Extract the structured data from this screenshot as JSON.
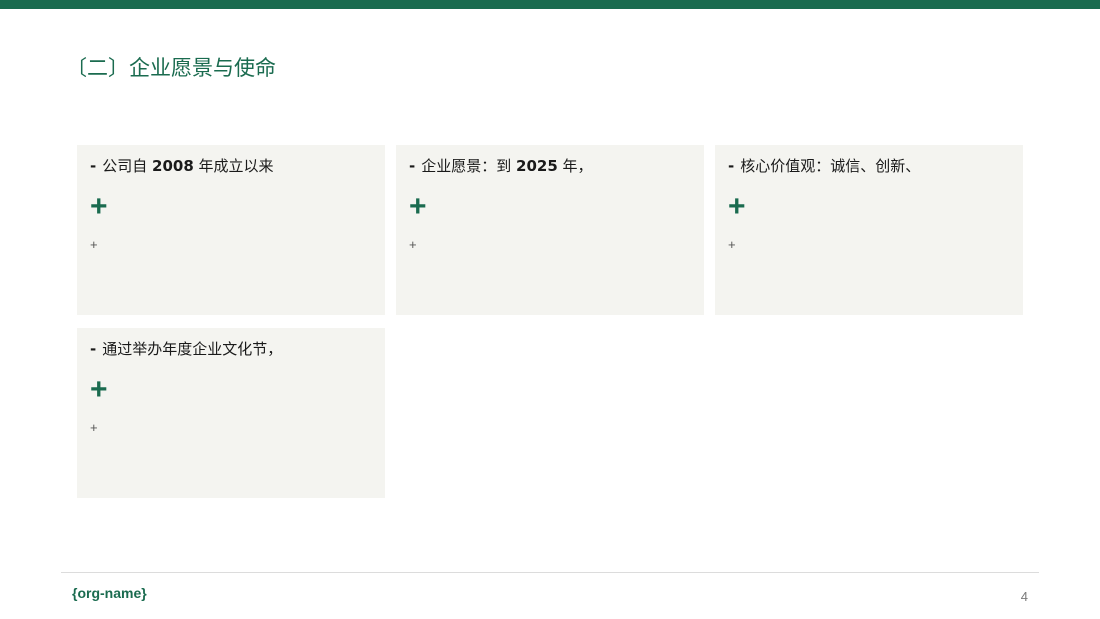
{
  "header": {
    "accent_color": "#1a6b4f"
  },
  "title": "〔二〕企业愿景与使命",
  "cards": [
    {
      "dash": "-",
      "segments": [
        "公司自 ",
        "2008",
        " 年成立以来"
      ],
      "plus_large": "+",
      "plus_small": "+"
    },
    {
      "dash": "-",
      "segments": [
        "企业愿景：到 ",
        "2025",
        " 年，"
      ],
      "plus_large": "+",
      "plus_small": "+"
    },
    {
      "dash": "-",
      "segments": [
        "核心价值观：诚信、创新、",
        "",
        ""
      ],
      "plus_large": "+",
      "plus_small": "+"
    },
    {
      "dash": "-",
      "segments": [
        "通过举办年度企业文化节，",
        "",
        ""
      ],
      "plus_large": "+",
      "plus_small": "+"
    }
  ],
  "footer": {
    "org_name": "{org-name}",
    "page_number": "4"
  }
}
